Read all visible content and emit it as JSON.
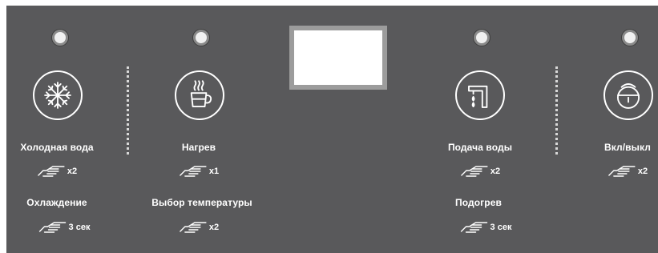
{
  "controls": {
    "cold": {
      "label": "Холодная вода",
      "press": "x2",
      "sub_label": "Охлаждение",
      "sub_press": "3 сек"
    },
    "heat": {
      "label": "Нагрев",
      "press": "x1",
      "sub_label": "Выбор температуры",
      "sub_press": "x2"
    },
    "supply": {
      "label": "Подача воды",
      "press": "x2",
      "sub_label": "Подогрев",
      "sub_press": "3 сек"
    },
    "power": {
      "label": "Вкл/выкл",
      "press": "x2"
    }
  },
  "icons": {
    "cold": "snowflake-icon",
    "heat": "hot-cup-icon",
    "supply": "faucet-icon",
    "power": "lock-icon",
    "gesture": "tap-hand-icon"
  },
  "colors": {
    "panel": "#59595b",
    "led": "#f1f1f1",
    "foreground": "#ffffff"
  }
}
